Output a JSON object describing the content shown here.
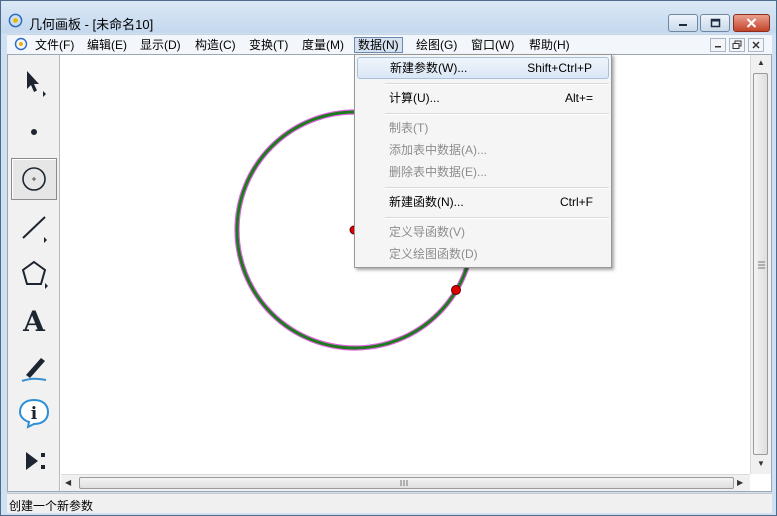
{
  "window": {
    "title": "几何画板 - [未命名10]"
  },
  "menubar": {
    "items": [
      {
        "label": "文件(F)"
      },
      {
        "label": "编辑(E)"
      },
      {
        "label": "显示(D)"
      },
      {
        "label": "构造(C)"
      },
      {
        "label": "变换(T)"
      },
      {
        "label": "度量(M)"
      },
      {
        "label": "数据(N)"
      },
      {
        "label": "绘图(G)"
      },
      {
        "label": "窗口(W)"
      },
      {
        "label": "帮助(H)"
      }
    ],
    "active_index": 6
  },
  "data_menu": {
    "items": [
      {
        "label": "新建参数(W)...",
        "shortcut": "Shift+Ctrl+P",
        "enabled": true,
        "highlighted": true
      },
      {
        "label": "计算(U)...",
        "shortcut": "Alt+=",
        "enabled": true
      },
      {
        "label": "制表(T)",
        "shortcut": "",
        "enabled": false
      },
      {
        "label": "添加表中数据(A)...",
        "shortcut": "",
        "enabled": false
      },
      {
        "label": "删除表中数据(E)...",
        "shortcut": "",
        "enabled": false
      },
      {
        "label": "新建函数(N)...",
        "shortcut": "Ctrl+F",
        "enabled": true
      },
      {
        "label": "定义导函数(V)",
        "shortcut": "",
        "enabled": false
      },
      {
        "label": "定义绘图函数(D)",
        "shortcut": "",
        "enabled": false
      }
    ]
  },
  "toolbox": {
    "tools": [
      {
        "icon": "arrow-select-icon"
      },
      {
        "icon": "point-icon"
      },
      {
        "icon": "compass-circle-icon",
        "selected": true
      },
      {
        "icon": "straightedge-icon"
      },
      {
        "icon": "polygon-icon"
      },
      {
        "icon": "text-icon",
        "glyph": "A"
      },
      {
        "icon": "marker-icon"
      },
      {
        "icon": "info-icon",
        "glyph": "i"
      },
      {
        "icon": "custom-tool-icon"
      }
    ]
  },
  "colors": {
    "circle_stroke": "#1e7a1e",
    "circle_highlight": "#e05ce0",
    "point_fill": "#e00000",
    "menu_highlight": "#dbe7f5"
  },
  "statusbar": {
    "text": "创建一个新参数"
  }
}
